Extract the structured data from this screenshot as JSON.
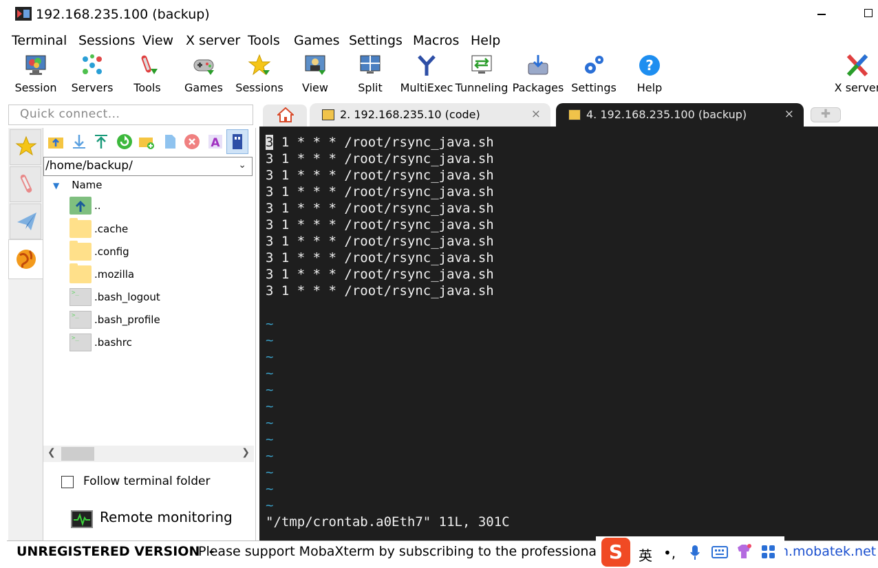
{
  "window": {
    "title": "192.168.235.100 (backup)"
  },
  "menu": [
    "Terminal",
    "Sessions",
    "View",
    "X server",
    "Tools",
    "Games",
    "Settings",
    "Macros",
    "Help"
  ],
  "toolbar": [
    {
      "label": "Session",
      "icon": "session-icon"
    },
    {
      "label": "Servers",
      "icon": "servers-icon"
    },
    {
      "label": "Tools",
      "icon": "tools-icon"
    },
    {
      "label": "Games",
      "icon": "games-icon"
    },
    {
      "label": "Sessions",
      "icon": "sessions-star-icon"
    },
    {
      "label": "View",
      "icon": "view-icon"
    },
    {
      "label": "Split",
      "icon": "split-icon"
    },
    {
      "label": "MultiExec",
      "icon": "multiexec-icon"
    },
    {
      "label": "Tunneling",
      "icon": "tunneling-icon"
    },
    {
      "label": "Packages",
      "icon": "packages-icon"
    },
    {
      "label": "Settings",
      "icon": "settings-icon"
    },
    {
      "label": "Help",
      "icon": "help-icon"
    },
    {
      "label": "X server",
      "icon": "xserver-icon"
    }
  ],
  "quick_connect": {
    "placeholder": "Quick connect..."
  },
  "tabs": [
    {
      "label": "2. 192.168.235.10 (code)",
      "close": "×"
    },
    {
      "label": "4. 192.168.235.100 (backup)",
      "close": "×"
    }
  ],
  "file_panel": {
    "path": "/home/backup/",
    "column_header": "Name",
    "files": [
      {
        "name": "..",
        "type": "up"
      },
      {
        "name": ".cache",
        "type": "folder"
      },
      {
        "name": ".config",
        "type": "folder"
      },
      {
        "name": ".mozilla",
        "type": "folder"
      },
      {
        "name": ".bash_logout",
        "type": "shell"
      },
      {
        "name": ".bash_profile",
        "type": "shell"
      },
      {
        "name": ".bashrc",
        "type": "shell"
      }
    ],
    "follow_terminal_folder": "Follow terminal folder",
    "remote_monitoring": "Remote monitoring"
  },
  "terminal": {
    "lines": [
      "3 1 * * * /root/rsync_java.sh",
      "3 1 * * * /root/rsync_java.sh",
      "3 1 * * * /root/rsync_java.sh",
      "3 1 * * * /root/rsync_java.sh",
      "3 1 * * * /root/rsync_java.sh",
      "3 1 * * * /root/rsync_java.sh",
      "3 1 * * * /root/rsync_java.sh",
      "3 1 * * * /root/rsync_java.sh",
      "3 1 * * * /root/rsync_java.sh",
      "3 1 * * * /root/rsync_java.sh"
    ],
    "tilde_count": 12,
    "status_line": "\"/tmp/crontab.a0Eth7\" 11L, 301C"
  },
  "statusbar": {
    "unregistered": "UNREGISTERED VERSION",
    "separator": "-",
    "message": "Please support MobaXterm by subscribing to the professional e",
    "link": "rm.mobatek.net"
  },
  "ime": {
    "sogou": "S",
    "mode": "英",
    "punct": "•,"
  }
}
